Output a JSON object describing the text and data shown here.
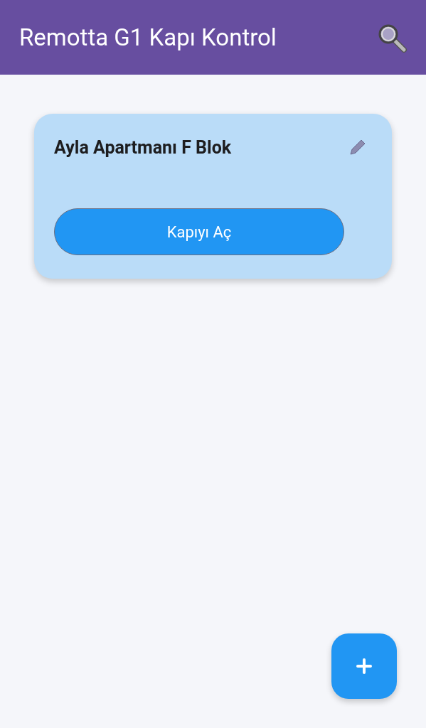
{
  "app_bar": {
    "title": "Remotta G1 Kapı Kontrol"
  },
  "devices": [
    {
      "name": "Ayla Apartmanı F Blok",
      "action": "Kapıyı Aç"
    }
  ]
}
